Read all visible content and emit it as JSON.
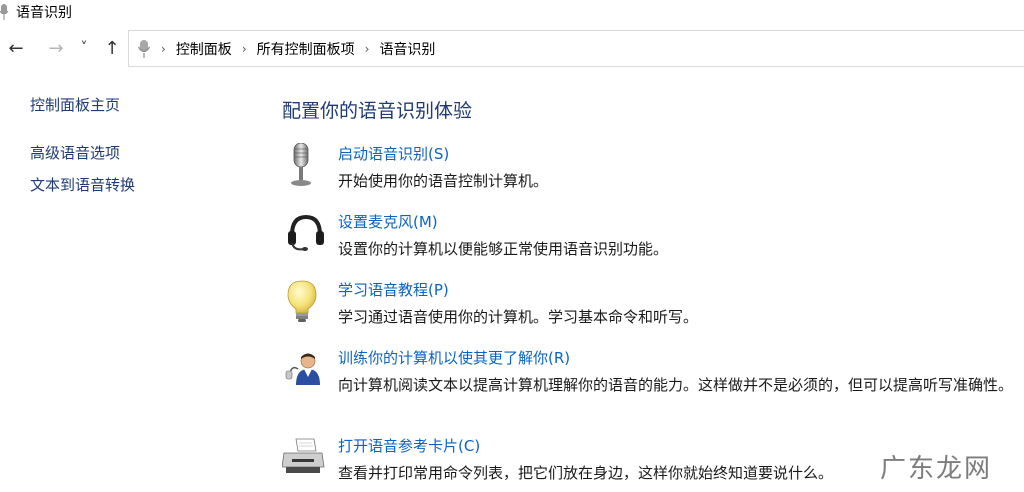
{
  "window": {
    "title": "语音识别"
  },
  "nav": {
    "back": "←",
    "forward": "→",
    "recent": "˅",
    "up": "↑"
  },
  "address": {
    "separator": "›",
    "crumbs": [
      "控制面板",
      "所有控制面板项",
      "语音识别"
    ]
  },
  "sidebar": {
    "items": [
      {
        "label": "控制面板主页"
      },
      {
        "label": "高级语音选项"
      },
      {
        "label": "文本到语音转换"
      }
    ]
  },
  "main": {
    "title": "配置你的语音识别体验",
    "tasks": [
      {
        "icon": "microphone-icon",
        "link": "启动语音识别(S)",
        "desc": "开始使用你的语音控制计算机。"
      },
      {
        "icon": "headset-icon",
        "link": "设置麦克风(M)",
        "desc": "设置你的计算机以便能够正常使用语音识别功能。"
      },
      {
        "icon": "lightbulb-icon",
        "link": "学习语音教程(P)",
        "desc": "学习通过语音使用你的计算机。学习基本命令和听写。"
      },
      {
        "icon": "user-training-icon",
        "link": "训练你的计算机以使其更了解你(R)",
        "desc": "向计算机阅读文本以提高计算机理解你的语音的能力。这样做并不是必须的，但可以提高听写准确性。"
      },
      {
        "icon": "printer-icon",
        "link": "打开语音参考卡片(C)",
        "desc": "查看并打印常用命令列表，把它们放在身边，这样你就始终知道要说什么。"
      }
    ]
  },
  "watermark": {
    "text": "广东龙网"
  }
}
